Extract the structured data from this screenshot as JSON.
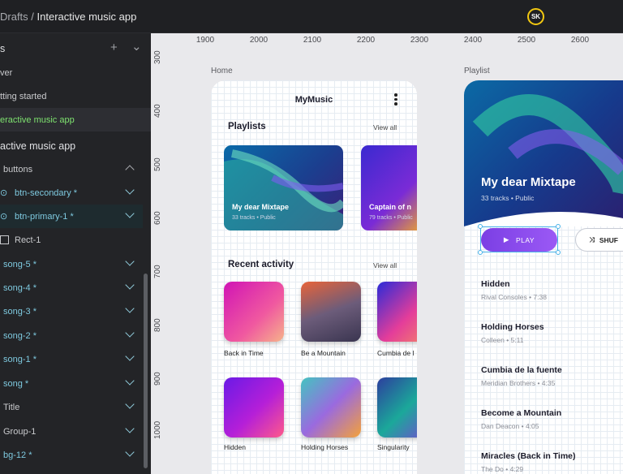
{
  "topbar": {
    "breadcrumb_root": "Drafts",
    "breadcrumb_sep": " / ",
    "breadcrumb_page": "Interactive music app",
    "avatar_initials": "SK"
  },
  "sidebar": {
    "pages_header": "s",
    "pages": [
      "ver",
      "tting started",
      "eractive music app"
    ],
    "layers_header": "active music app",
    "layers": [
      {
        "name": "buttons",
        "component": false
      },
      {
        "name": "btn-secondary *",
        "component": true
      },
      {
        "name": "btn-primary-1 *",
        "component": true
      },
      {
        "name": "Rect-1",
        "component": false
      },
      {
        "name": "song-5 *",
        "component": true
      },
      {
        "name": "song-4 *",
        "component": true
      },
      {
        "name": "song-3 *",
        "component": true
      },
      {
        "name": "song-2 *",
        "component": true
      },
      {
        "name": "song-1 *",
        "component": true
      },
      {
        "name": "song *",
        "component": true
      },
      {
        "name": "Title",
        "component": false
      },
      {
        "name": "Group-1",
        "component": false
      },
      {
        "name": "bg-12 *",
        "component": true
      }
    ]
  },
  "ruler": {
    "top": [
      "1900",
      "2000",
      "2100",
      "2200",
      "2300",
      "2400",
      "2500",
      "2600"
    ],
    "left": [
      "300",
      "400",
      "500",
      "600",
      "700",
      "800",
      "900",
      "1000"
    ]
  },
  "home": {
    "frame_label": "Home",
    "app_title": "MyMusic",
    "playlists_title": "Playlists",
    "playlists_view_all": "View all",
    "playlists": [
      {
        "name": "My dear Mixtape",
        "meta": "33 tracks • Public"
      },
      {
        "name": "Captain of n",
        "meta": "79 tracks • Public"
      }
    ],
    "recent_title": "Recent activity",
    "recent_view_all": "View all",
    "recent": [
      "Back in Time",
      "Be a Mountain",
      "Cumbia de l",
      "Hidden",
      "Holding Horses",
      "Singularity"
    ]
  },
  "playlist": {
    "frame_label": "Playlist",
    "title": "My dear Mixtape",
    "meta": "33 tracks • Public",
    "play_label": "PLAY",
    "shuffle_label": "SHUF",
    "songs": [
      {
        "title": "Hidden",
        "artist": "Rival Consoles",
        "duration": "7:38"
      },
      {
        "title": "Holding Horses",
        "artist": "Colleen",
        "duration": "5:11"
      },
      {
        "title": "Cumbia de la fuente",
        "artist": "Meridian Brothers",
        "duration": "4:35"
      },
      {
        "title": "Become a Mountain",
        "artist": "Dan Deacon",
        "duration": "4:05"
      },
      {
        "title": "Miracles (Back in Time)",
        "artist": "The Do",
        "duration": "4:29"
      }
    ]
  },
  "colors": {
    "accent_green": "#7ee26f",
    "component_blue": "#7ec9df",
    "play_purple": "#8a4cf0",
    "avatar_ring": "#f2c811"
  }
}
